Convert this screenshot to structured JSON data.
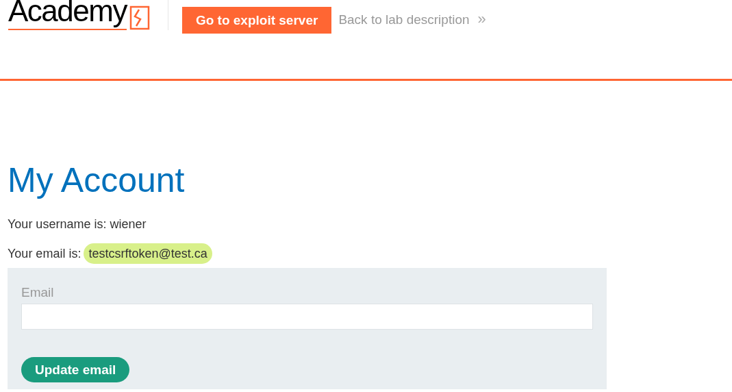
{
  "header": {
    "logo": {
      "text": "Academy"
    },
    "exploit_button": "Go to exploit server",
    "back_link": {
      "label": "Back to lab description",
      "arrow": "»"
    }
  },
  "page": {
    "title": "My Account",
    "username_line": "Your username is: wiener",
    "email_line": {
      "label": "Your email is:",
      "value": "testcsrftoken@test.ca",
      "highlighted": true
    },
    "form": {
      "email_label": "Email",
      "submit": "Update email"
    }
  }
}
